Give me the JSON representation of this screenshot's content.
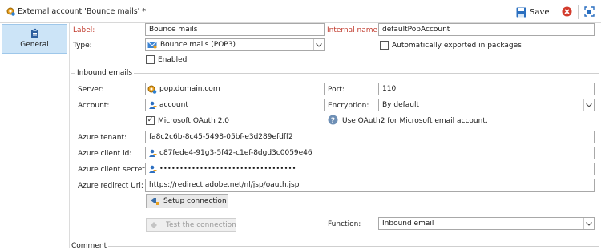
{
  "window": {
    "title": "External account 'Bounce mails' *"
  },
  "toolbar": {
    "save_label": "Save"
  },
  "sidebar": {
    "tab_label": "General"
  },
  "form": {
    "label_label": "Label:",
    "label_value": "Bounce mails",
    "internal_name_label": "Internal name:",
    "internal_name_value": "defaultPopAccount",
    "type_label": "Type:",
    "type_value": "Bounce mails (POP3)",
    "auto_export_label": "Automatically exported in packages",
    "enabled_label": "Enabled"
  },
  "inbound": {
    "group_title": "Inbound emails",
    "server_label": "Server:",
    "server_value": "pop.domain.com",
    "port_label": "Port:",
    "port_value": "110",
    "account_label": "Account:",
    "account_value": "account",
    "encryption_label": "Encryption:",
    "encryption_value": "By default",
    "oauth_label": "Microsoft OAuth 2.0",
    "oauth_checked": true,
    "oauth_hint": "Use OAuth2 for Microsoft email account.",
    "tenant_label": "Azure tenant:",
    "tenant_value": "fa8c2c6b-8c45-5498-05bf-e3d289efdff2",
    "client_id_label": "Azure client id:",
    "client_id_value": "c87fede4-91g3-5f42-c1ef-8dgd3c0059e46",
    "client_secret_label": "Azure client secret:",
    "client_secret_value": "••••••••••••••••••••••••••••••••••",
    "redirect_label": "Azure redirect Url:",
    "redirect_value": "https://redirect.adobe.net/nl/jsp/oauth.jsp",
    "setup_button": "Setup connection",
    "test_button": "Test the connection",
    "function_label": "Function:",
    "function_value": "Inbound email"
  },
  "comment": {
    "group_title": "Comment"
  },
  "colors": {
    "accent": "#1e73be",
    "required_label": "#c0392b",
    "selected_tab": "#cce4f7"
  }
}
